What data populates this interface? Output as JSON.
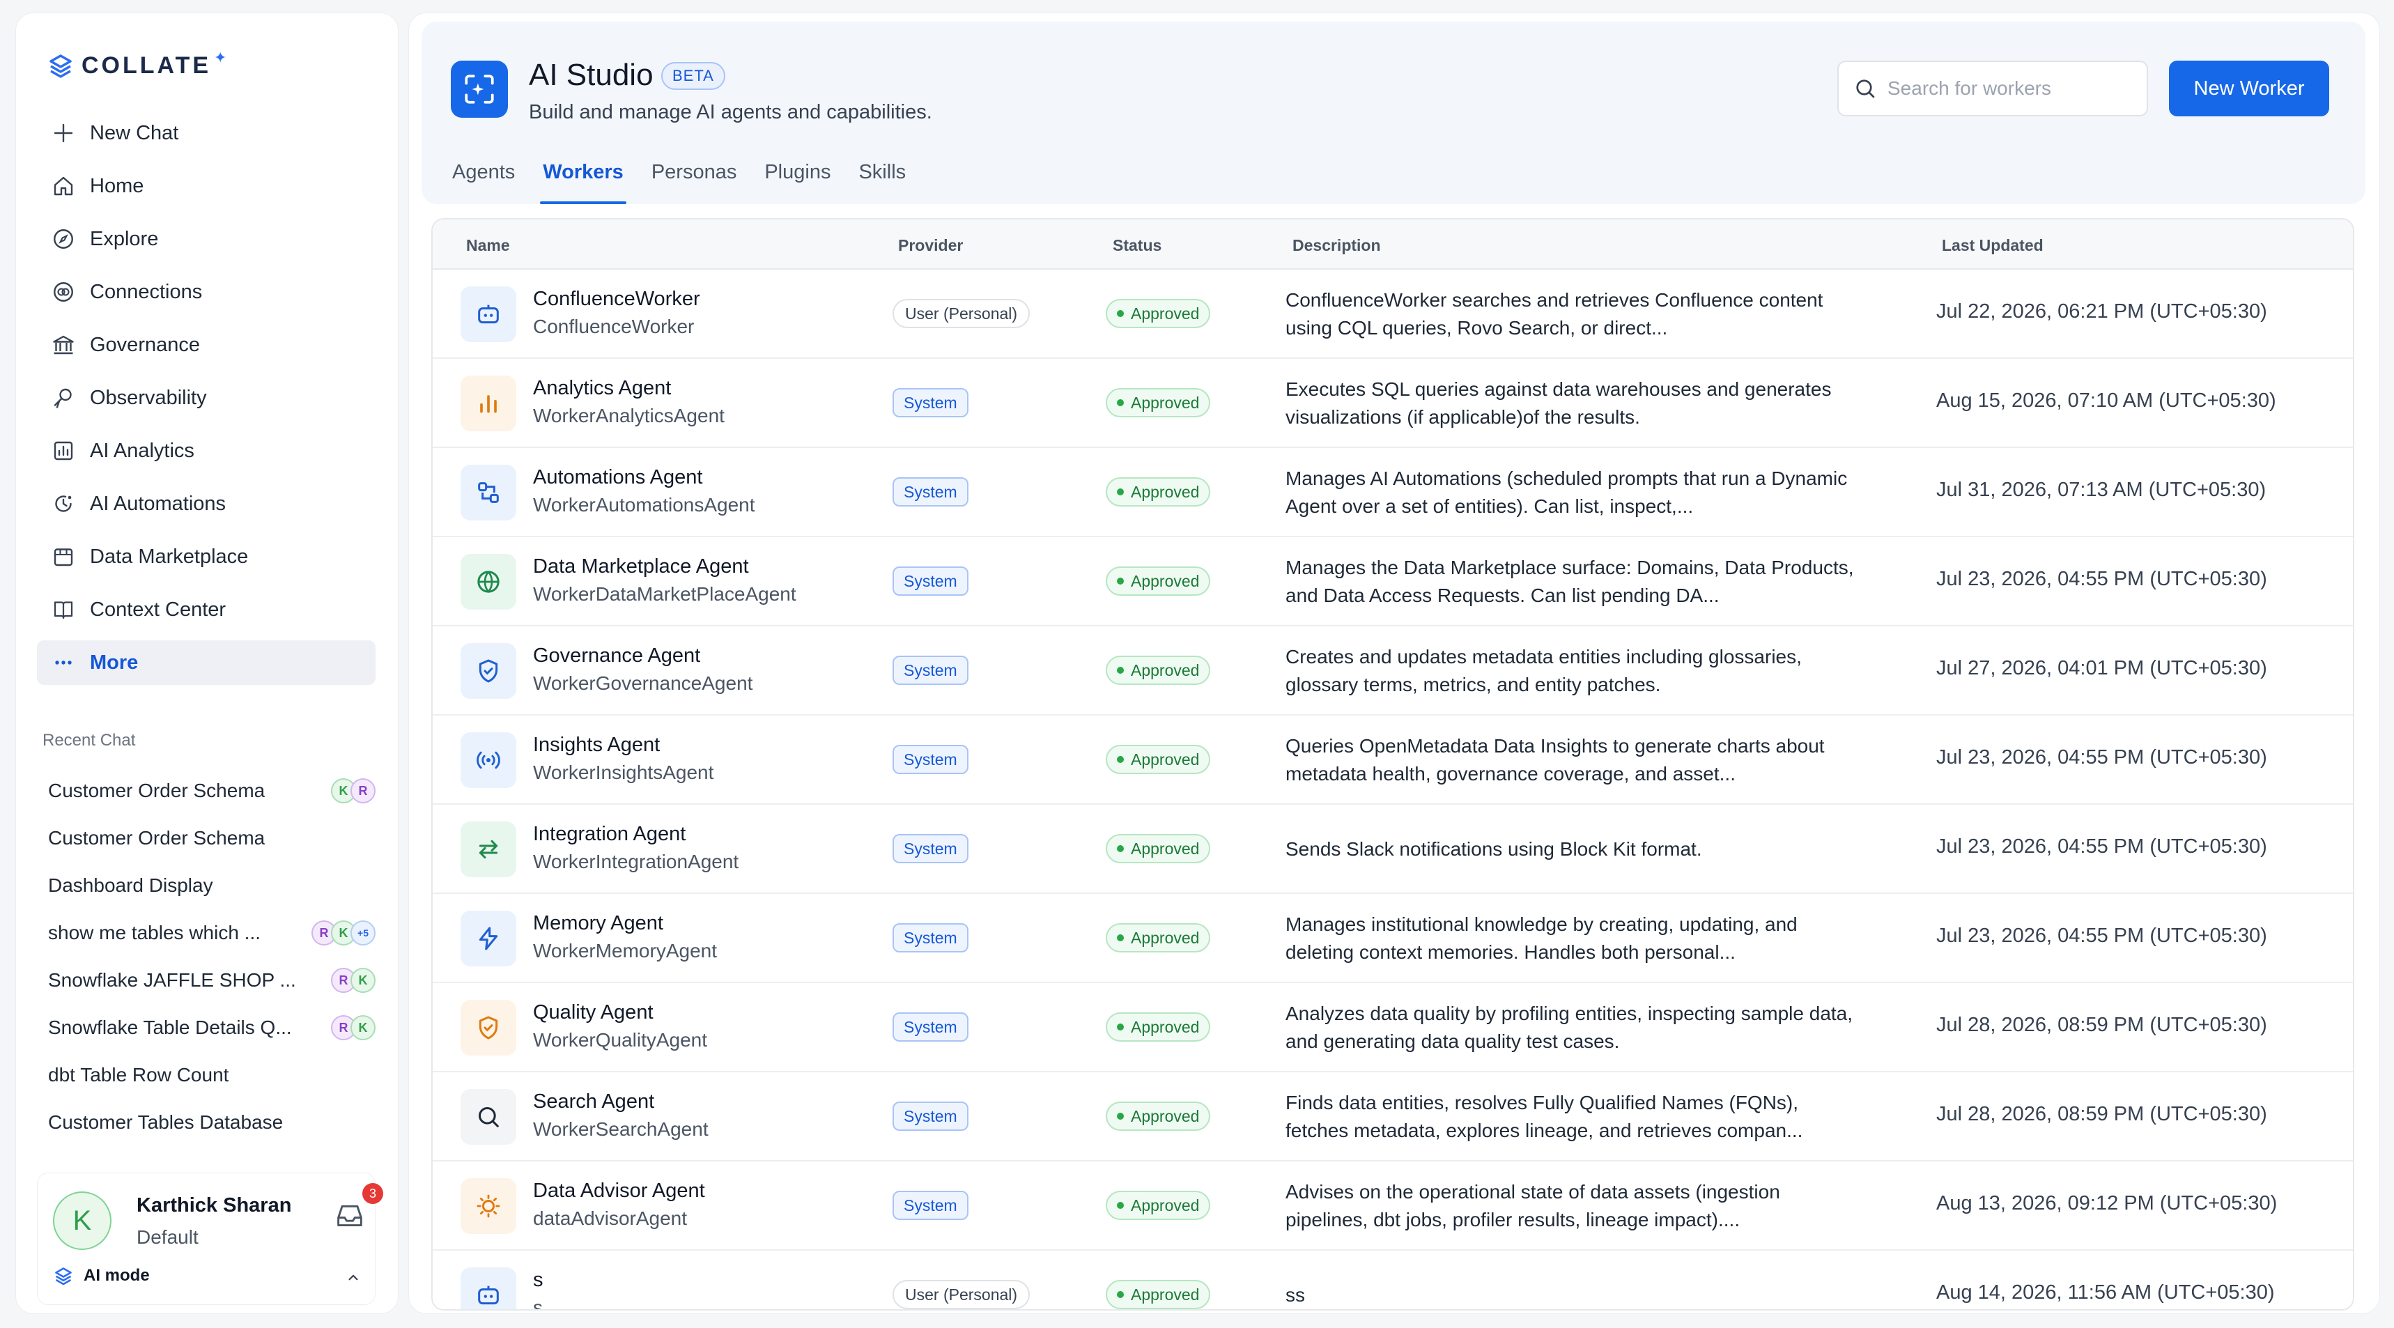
{
  "brand": {
    "logo_text": "COLLATE",
    "logo_mark": "✦"
  },
  "nav": [
    {
      "label": "New Chat",
      "icon": "plus-icon"
    },
    {
      "label": "Home",
      "icon": "home-icon"
    },
    {
      "label": "Explore",
      "icon": "compass-icon"
    },
    {
      "label": "Connections",
      "icon": "connections-icon"
    },
    {
      "label": "Governance",
      "icon": "bank-icon"
    },
    {
      "label": "Observability",
      "icon": "telescope-icon"
    },
    {
      "label": "AI Analytics",
      "icon": "chart-icon"
    },
    {
      "label": "AI Automations",
      "icon": "automation-icon"
    },
    {
      "label": "Data Marketplace",
      "icon": "store-icon"
    },
    {
      "label": "Context Center",
      "icon": "book-icon"
    },
    {
      "label": "More",
      "icon": "ellipsis-icon"
    }
  ],
  "recent": {
    "title": "Recent Chat",
    "items": [
      {
        "label": "Customer Order Schema",
        "avatars": [
          "K",
          "R"
        ]
      },
      {
        "label": "Customer Order Schema",
        "avatars": []
      },
      {
        "label": "Dashboard Display",
        "avatars": []
      },
      {
        "label": "show me tables which ...",
        "avatars": [
          "R",
          "K",
          "+5"
        ]
      },
      {
        "label": "Snowflake JAFFLE SHOP ...",
        "avatars": [
          "R",
          "K"
        ]
      },
      {
        "label": "Snowflake Table Details Q...",
        "avatars": [
          "R",
          "K"
        ]
      },
      {
        "label": "dbt Table Row Count",
        "avatars": []
      },
      {
        "label": "Customer Tables Database",
        "avatars": []
      }
    ]
  },
  "user": {
    "initial": "K",
    "name": "Karthick Sharan",
    "role": "Default",
    "notification_count": "3",
    "ai_mode_label": "AI mode"
  },
  "header": {
    "title": "AI Studio",
    "badge": "BETA",
    "subtitle": "Build and manage AI agents and capabilities.",
    "search_placeholder": "Search for workers",
    "new_button": "New Worker",
    "tabs": [
      "Agents",
      "Workers",
      "Personas",
      "Plugins",
      "Skills"
    ],
    "active_tab": "Workers"
  },
  "table": {
    "columns": [
      "Name",
      "Provider",
      "Status",
      "Description",
      "Last Updated"
    ],
    "rows": [
      {
        "name": "ConfluenceWorker",
        "sub": "ConfluenceWorker",
        "provider": "User (Personal)",
        "status": "Approved",
        "description": "ConfluenceWorker searches and retrieves Confluence content using CQL queries, Rovo Search, or direct...",
        "updated": "Jul 22, 2026, 06:21 PM (UTC+05:30)",
        "icon": "worker-bot-icon",
        "tint": "#eaf2fd",
        "color": "#1f5fd1"
      },
      {
        "name": "Analytics Agent",
        "sub": "WorkerAnalyticsAgent",
        "provider": "System",
        "status": "Approved",
        "description": "Executes SQL queries against data warehouses and generates visualizations (if applicable)of the results.",
        "updated": "Aug 15, 2026, 07:10 AM (UTC+05:30)",
        "icon": "bar-chart-icon",
        "tint": "#fdf3e6",
        "color": "#e07a10"
      },
      {
        "name": "Automations Agent",
        "sub": "WorkerAutomationsAgent",
        "provider": "System",
        "status": "Approved",
        "description": "Manages AI Automations (scheduled prompts that run a Dynamic Agent over a set of entities). Can list, inspect,...",
        "updated": "Jul 31, 2026, 07:13 AM (UTC+05:30)",
        "icon": "automation-flow-icon",
        "tint": "#eaf2fd",
        "color": "#1f5fd1"
      },
      {
        "name": "Data Marketplace Agent",
        "sub": "WorkerDataMarketPlaceAgent",
        "provider": "System",
        "status": "Approved",
        "description": "Manages the Data Marketplace surface: Domains, Data Products, and Data Access Requests. Can list pending DA...",
        "updated": "Jul 23, 2026, 04:55 PM (UTC+05:30)",
        "icon": "globe-icon",
        "tint": "#e8f7ee",
        "color": "#1f8a4c"
      },
      {
        "name": "Governance Agent",
        "sub": "WorkerGovernanceAgent",
        "provider": "System",
        "status": "Approved",
        "description": "Creates and updates metadata entities including glossaries, glossary terms, metrics, and entity patches.",
        "updated": "Jul 27, 2026, 04:01 PM (UTC+05:30)",
        "icon": "shield-check-icon",
        "tint": "#eaf2fd",
        "color": "#1f5fd1"
      },
      {
        "name": "Insights Agent",
        "sub": "WorkerInsightsAgent",
        "provider": "System",
        "status": "Approved",
        "description": "Queries OpenMetadata Data Insights to generate charts about metadata health, governance coverage, and asset...",
        "updated": "Jul 23, 2026, 04:55 PM (UTC+05:30)",
        "icon": "broadcast-icon",
        "tint": "#eaf2fd",
        "color": "#1f5fd1"
      },
      {
        "name": "Integration Agent",
        "sub": "WorkerIntegrationAgent",
        "provider": "System",
        "status": "Approved",
        "description": "Sends Slack notifications using Block Kit format.",
        "updated": "Jul 23, 2026, 04:55 PM (UTC+05:30)",
        "icon": "arrows-swap-icon",
        "tint": "#e8f7ee",
        "color": "#1f8a4c"
      },
      {
        "name": "Memory Agent",
        "sub": "WorkerMemoryAgent",
        "provider": "System",
        "status": "Approved",
        "description": "Manages institutional knowledge by creating, updating, and deleting context memories. Handles both personal...",
        "updated": "Jul 23, 2026, 04:55 PM (UTC+05:30)",
        "icon": "lightning-icon",
        "tint": "#eaf2fd",
        "color": "#1f5fd1"
      },
      {
        "name": "Quality Agent",
        "sub": "WorkerQualityAgent",
        "provider": "System",
        "status": "Approved",
        "description": "Analyzes data quality by profiling entities, inspecting sample data, and generating data quality test cases.",
        "updated": "Jul 28, 2026, 08:59 PM (UTC+05:30)",
        "icon": "shield-badge-icon",
        "tint": "#fdf3e6",
        "color": "#e07a10"
      },
      {
        "name": "Search Agent",
        "sub": "WorkerSearchAgent",
        "provider": "System",
        "status": "Approved",
        "description": "Finds data entities, resolves Fully Qualified Names (FQNs), fetches metadata, explores lineage, and retrieves compan...",
        "updated": "Jul 28, 2026, 08:59 PM (UTC+05:30)",
        "icon": "search-icon",
        "tint": "#f3f4f6",
        "color": "#1f2937"
      },
      {
        "name": "Data Advisor Agent",
        "sub": "dataAdvisorAgent",
        "provider": "System",
        "status": "Approved",
        "description": "Advises on the operational state of data assets (ingestion pipelines, dbt jobs, profiler results, lineage impact)....",
        "updated": "Aug 13, 2026, 09:12 PM (UTC+05:30)",
        "icon": "bulb-icon",
        "tint": "#fdf3e6",
        "color": "#e07a10"
      },
      {
        "name": "s",
        "sub": "s",
        "provider": "User (Personal)",
        "status": "Approved",
        "description": "ss",
        "updated": "Aug 14, 2026, 11:56 AM (UTC+05:30)",
        "icon": "worker-bot-icon",
        "tint": "#eaf2fd",
        "color": "#1f5fd1"
      }
    ]
  }
}
